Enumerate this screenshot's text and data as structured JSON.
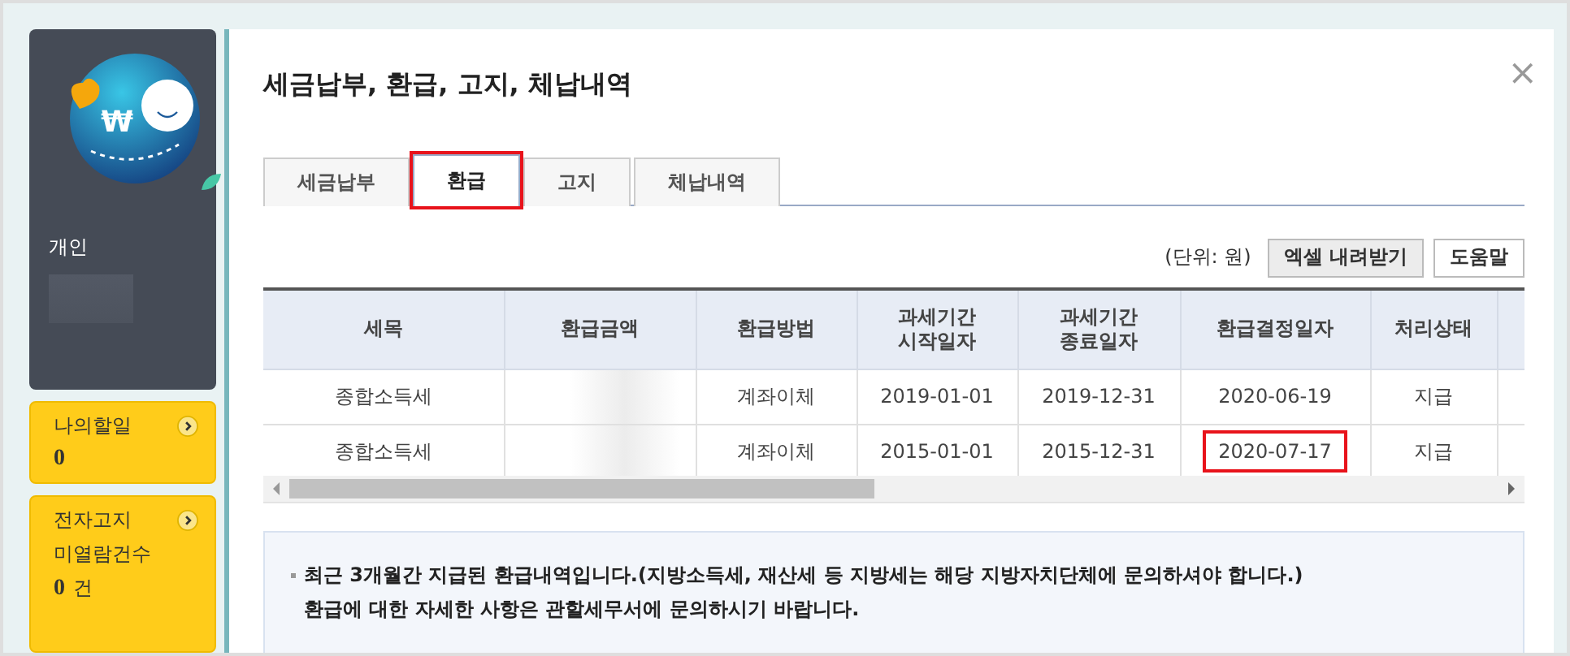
{
  "sidebar": {
    "profile": {
      "logo_symbol": "₩",
      "label": "개인"
    },
    "cards": [
      {
        "title": "나의할일",
        "count": "0"
      },
      {
        "title": "전자고지",
        "subtitle": "미열람건수",
        "count": "0",
        "unit": "건"
      }
    ]
  },
  "dialog": {
    "title": "세금납부, 환급, 고지, 체납내역",
    "close": "×",
    "tabs": [
      {
        "label": "세금납부",
        "selected": false,
        "highlighted": false
      },
      {
        "label": "환급",
        "selected": true,
        "highlighted": true
      },
      {
        "label": "고지",
        "selected": false,
        "highlighted": false
      },
      {
        "label": "체납내역",
        "selected": false,
        "highlighted": false
      }
    ],
    "unit_note": "(단위: 원)",
    "buttons": [
      "엑셀 내려받기",
      "도움말"
    ],
    "table": {
      "columns": [
        "세목",
        "환급금액",
        "환급방법",
        "과세기간\n시작일자",
        "과세기간\n종료일자",
        "환급결정일자",
        "처리상태"
      ],
      "rows": [
        {
          "cells": [
            {
              "kind": "text",
              "text": "종합소득세",
              "highlighted": false
            },
            {
              "kind": "blurred"
            },
            {
              "kind": "text",
              "text": "계좌이체",
              "highlighted": false
            },
            {
              "kind": "text",
              "text": "2019-01-01",
              "highlighted": false
            },
            {
              "kind": "text",
              "text": "2019-12-31",
              "highlighted": false
            },
            {
              "kind": "text",
              "text": "2020-06-19",
              "highlighted": false
            },
            {
              "kind": "text",
              "text": "지급",
              "highlighted": false
            }
          ]
        },
        {
          "cells": [
            {
              "kind": "text",
              "text": "종합소득세",
              "highlighted": false
            },
            {
              "kind": "blurred"
            },
            {
              "kind": "text",
              "text": "계좌이체",
              "highlighted": false
            },
            {
              "kind": "text",
              "text": "2015-01-01",
              "highlighted": false
            },
            {
              "kind": "text",
              "text": "2015-12-31",
              "highlighted": false
            },
            {
              "kind": "text",
              "text": "2020-07-17",
              "highlighted": true
            },
            {
              "kind": "text",
              "text": "지급",
              "highlighted": false
            }
          ]
        }
      ]
    },
    "notes": [
      "최근 3개월간 지급된 환급내역입니다.(지방소득세, 재산세 등 지방세는 해당 지방자치단체에 문의하셔야 합니다.)",
      "환급에 대한 자세한 사항은 관할세무서에 문의하시기 바랍니다."
    ]
  }
}
